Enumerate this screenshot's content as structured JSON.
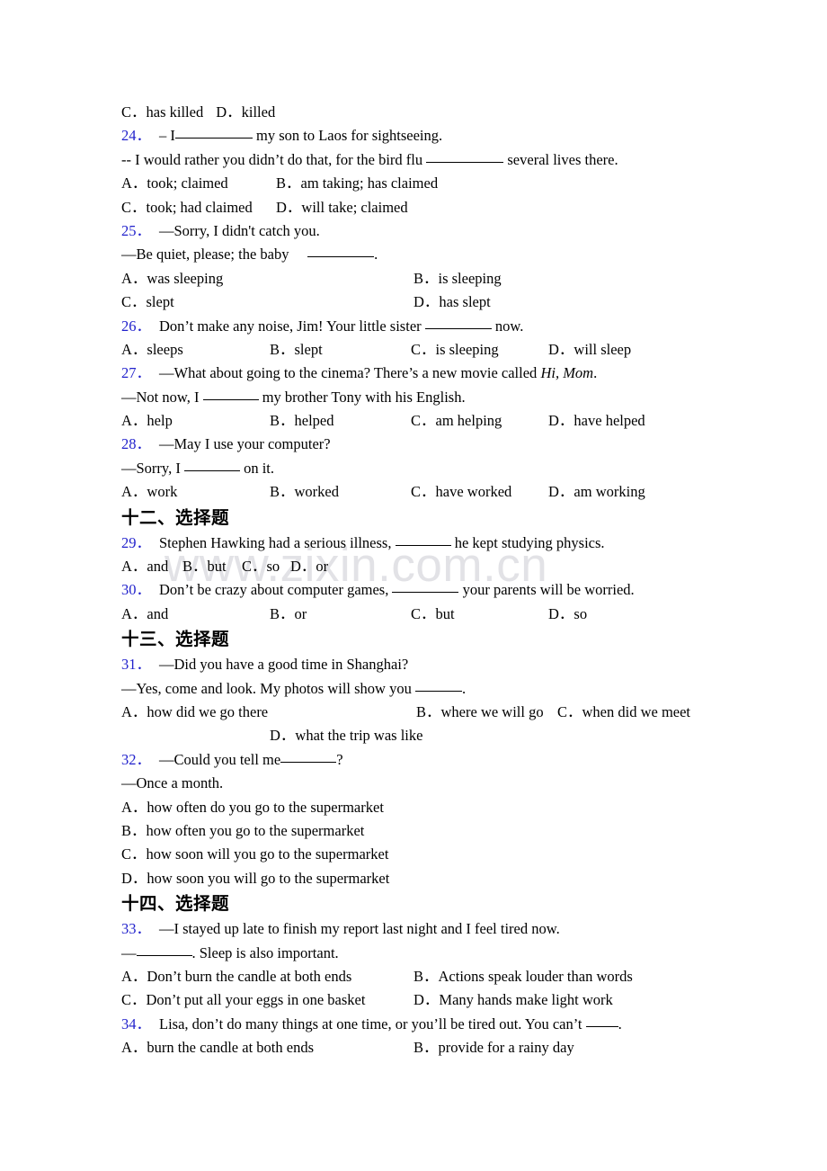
{
  "watermark": {
    "text": "www.zixin.com.cn"
  },
  "colors": {
    "question_number": "#2222cc",
    "text": "#000000",
    "watermark": "#e2e2e6"
  },
  "document": {
    "carryover_options": {
      "c": "C．has killed",
      "d": "D．killed"
    },
    "sections": [
      {
        "id": "section-12",
        "heading": "十二、选择题",
        "heading_visible": false
      }
    ],
    "q24": {
      "num": "24．",
      "stem_1_before": "– I",
      "stem_1_after": "my son to Laos for sightseeing.",
      "stem_2_before": "-- I would rather you didn’t do that, for the bird flu",
      "stem_2_after": "several lives there.",
      "opt_a": "A．took; claimed",
      "opt_b": "B．am taking; has claimed",
      "opt_c": "C．took; had claimed",
      "opt_d": "D．will take; claimed"
    },
    "q25": {
      "num": "25．",
      "stem_1": "—Sorry, I didn't catch you.",
      "stem_2_before": "—Be quiet, please; the baby",
      "stem_2_after": ".",
      "opt_a": "A．was sleeping",
      "opt_b": "B．is sleeping",
      "opt_c": "C．slept",
      "opt_d": "D．has slept"
    },
    "q26": {
      "num": "26．",
      "stem_before": "Don’t make any noise, Jim! Your little sister",
      "stem_after": "now.",
      "opt_a": "A．sleeps",
      "opt_b": "B．slept",
      "opt_c": "C．is sleeping",
      "opt_d": "D．will sleep"
    },
    "q27": {
      "num": "27．",
      "stem_1_before": "—What about going to the cinema? There’s a new movie called",
      "stem_1_italic": "Hi, Mom",
      "stem_1_after": ".",
      "stem_2_before": "—Not now, I",
      "stem_2_after": "my brother Tony with his English.",
      "opt_a": "A．help",
      "opt_b": "B．helped",
      "opt_c": "C．am helping",
      "opt_d": "D．have helped"
    },
    "q28": {
      "num": "28．",
      "stem_1": "—May I use your computer?",
      "stem_2_before": "—Sorry, I",
      "stem_2_after": "on it.",
      "opt_a": "A．work",
      "opt_b": "B．worked",
      "opt_c": "C．have worked",
      "opt_d": "D．am working"
    },
    "heading_12": "十二、选择题",
    "q29": {
      "num": "29．",
      "stem_before": "Stephen Hawking had a serious illness,",
      "stem_after": "he kept studying physics.",
      "opt_a": "A．and",
      "opt_b": "B．but",
      "opt_c": "C．so",
      "opt_d": "D．or"
    },
    "q30": {
      "num": "30．",
      "stem_before": "Don’t be crazy about computer games,",
      "stem_after": "your parents will be worried.",
      "opt_a": "A．and",
      "opt_b": "B．or",
      "opt_c": "C．but",
      "opt_d": "D．so"
    },
    "heading_13": "十三、选择题",
    "q31": {
      "num": "31．",
      "stem_1": "—Did you have a good time in Shanghai?",
      "stem_2_before": "—Yes, come and look. My photos will show you",
      "stem_2_after": ".",
      "opt_a": "A．how did we go there",
      "opt_b": "B．where we will go",
      "opt_c": "C．when did we meet",
      "opt_d": "D．what the trip was like"
    },
    "q32": {
      "num": "32．",
      "stem_1_before": "—Could you tell me",
      "stem_1_after": "?",
      "stem_2": "—Once a month.",
      "opt_a": "A．how often do you go to the supermarket",
      "opt_b": "B．how often you go to the supermarket",
      "opt_c": "C．how soon will you go to the supermarket",
      "opt_d": "D．how soon you will go to the supermarket"
    },
    "heading_14": "十四、选择题",
    "q33": {
      "num": "33．",
      "stem_1": "—I stayed up late to finish my report last night and I feel tired now.",
      "stem_2_before": "—",
      "stem_2_after": ". Sleep is also important.",
      "opt_a": "A．Don’t burn the candle at both ends",
      "opt_b": "B．Actions speak louder than words",
      "opt_c": "C．Don’t put all your eggs in one basket",
      "opt_d": "D．Many hands make light work"
    },
    "q34": {
      "num": "34．",
      "stem_before": "Lisa, don’t do many things at one time, or you’ll be tired out. You can’t",
      "stem_after": ".",
      "opt_a": "A．burn the candle at both ends",
      "opt_b": "B．provide for a rainy day"
    }
  }
}
